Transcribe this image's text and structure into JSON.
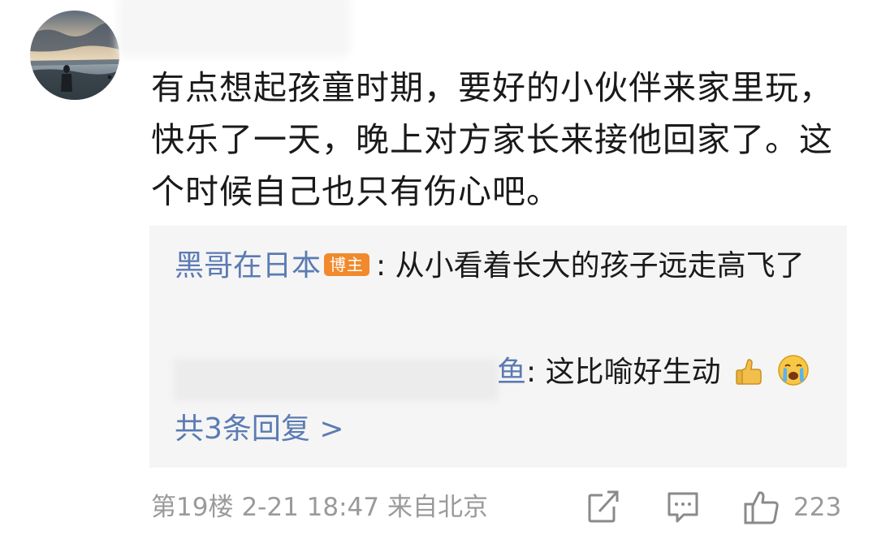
{
  "comment": {
    "text": "有点想起孩童时期，要好的小伙伴来家里玩，快乐了一天，晚上对方家长来接他回家了。这个时候自己也只有伤心吧。"
  },
  "replies": [
    {
      "name": "黑哥在日本",
      "badge": "博主",
      "separator": ":",
      "text": "从小看着长大的孩子远走高飞了"
    },
    {
      "name_tail": "鱼",
      "separator": ":",
      "text": "这比喻好生动"
    }
  ],
  "more_replies_label": "共3条回复 >",
  "footer": {
    "floor": "第19楼",
    "time": "2-21 18:47",
    "location": "来自北京",
    "like_count": "223"
  },
  "icons": {
    "share": "share-icon",
    "comment": "comment-icon",
    "like": "thumbs-up-icon",
    "emoji_1": "thumbs-up-emoji",
    "emoji_2": "crying-face-emoji"
  },
  "colors": {
    "link": "#5b7bb3",
    "badge": "#f08a2c",
    "meta": "#9a9a9a",
    "reply_bg": "#f5f5f5"
  }
}
